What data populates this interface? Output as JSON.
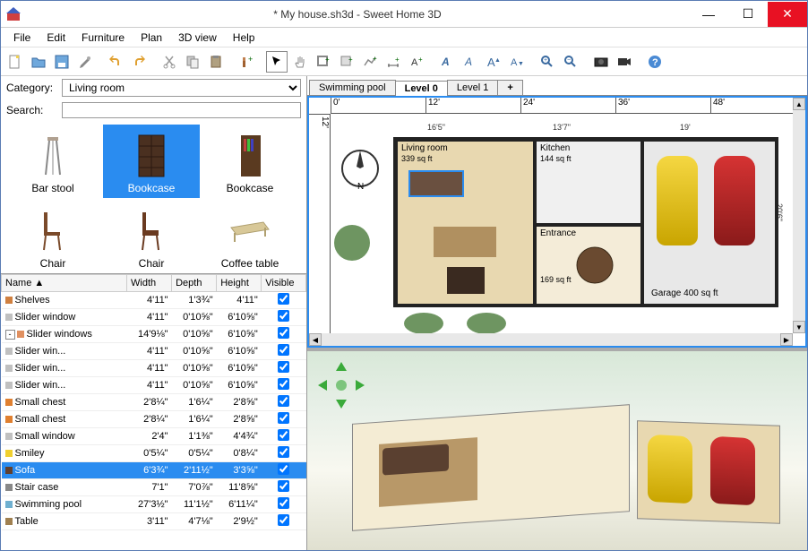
{
  "window": {
    "title": "* My house.sh3d - Sweet Home 3D"
  },
  "menu": {
    "file": "File",
    "edit": "Edit",
    "furniture": "Furniture",
    "plan": "Plan",
    "view3d": "3D view",
    "help": "Help"
  },
  "catalog": {
    "category_label": "Category:",
    "category_value": "Living room",
    "search_label": "Search:",
    "search_value": "",
    "items": [
      {
        "label": "Bar stool",
        "selected": false
      },
      {
        "label": "Bookcase",
        "selected": true
      },
      {
        "label": "Bookcase",
        "selected": false
      },
      {
        "label": "Chair",
        "selected": false
      },
      {
        "label": "Chair",
        "selected": false
      },
      {
        "label": "Coffee table",
        "selected": false
      }
    ]
  },
  "furniture_table": {
    "headers": {
      "name": "Name ▲",
      "width": "Width",
      "depth": "Depth",
      "height": "Height",
      "visible": "Visible"
    },
    "rows": [
      {
        "indent": 1,
        "icon": "#d08040",
        "name": "Shelves",
        "width": "4'11\"",
        "depth": "1'3¾\"",
        "height": "4'11\"",
        "visible": true
      },
      {
        "indent": 1,
        "icon": "#c0c0c0",
        "name": "Slider window",
        "width": "4'11\"",
        "depth": "0'10⅝\"",
        "height": "6'10⅝\"",
        "visible": true
      },
      {
        "indent": 0,
        "expand": "-",
        "icon": "#e09060",
        "name": "Slider windows",
        "width": "14'9⅛\"",
        "depth": "0'10⅝\"",
        "height": "6'10⅝\"",
        "visible": true
      },
      {
        "indent": 2,
        "icon": "#c0c0c0",
        "name": "Slider win...",
        "width": "4'11\"",
        "depth": "0'10⅝\"",
        "height": "6'10⅝\"",
        "visible": true
      },
      {
        "indent": 2,
        "icon": "#c0c0c0",
        "name": "Slider win...",
        "width": "4'11\"",
        "depth": "0'10⅝\"",
        "height": "6'10⅝\"",
        "visible": true
      },
      {
        "indent": 2,
        "icon": "#c0c0c0",
        "name": "Slider win...",
        "width": "4'11\"",
        "depth": "0'10⅝\"",
        "height": "6'10⅝\"",
        "visible": true
      },
      {
        "indent": 1,
        "icon": "#e08030",
        "name": "Small chest",
        "width": "2'8¼\"",
        "depth": "1'6¼\"",
        "height": "2'8⅝\"",
        "visible": true
      },
      {
        "indent": 1,
        "icon": "#e08030",
        "name": "Small chest",
        "width": "2'8¼\"",
        "depth": "1'6¼\"",
        "height": "2'8⅝\"",
        "visible": true
      },
      {
        "indent": 1,
        "icon": "#c0c0c0",
        "name": "Small window",
        "width": "2'4\"",
        "depth": "1'1⅜\"",
        "height": "4'4¾\"",
        "visible": true
      },
      {
        "indent": 1,
        "icon": "#f0d030",
        "name": "Smiley",
        "width": "0'5¼\"",
        "depth": "0'5¼\"",
        "height": "0'8¼\"",
        "visible": true
      },
      {
        "indent": 1,
        "icon": "#604030",
        "name": "Sofa",
        "width": "6'3¾\"",
        "depth": "2'11½\"",
        "height": "3'3⅝\"",
        "visible": true,
        "selected": true
      },
      {
        "indent": 1,
        "icon": "#888888",
        "name": "Stair case",
        "width": "7'1\"",
        "depth": "7'0⅞\"",
        "height": "11'8⅝\"",
        "visible": true
      },
      {
        "indent": 1,
        "icon": "#70b0d0",
        "name": "Swimming pool",
        "width": "27'3½\"",
        "depth": "11'1½\"",
        "height": "6'11¼\"",
        "visible": true
      },
      {
        "indent": 1,
        "icon": "#a08050",
        "name": "Table",
        "width": "3'11\"",
        "depth": "4'7⅛\"",
        "height": "2'9½\"",
        "visible": true
      }
    ]
  },
  "tabs": {
    "items": [
      "Swimming pool",
      "Level 0",
      "Level 1"
    ],
    "active": "Level 0",
    "add": "+"
  },
  "plan": {
    "ruler_h": [
      "0'",
      "12'",
      "24'",
      "36'",
      "48'"
    ],
    "ruler_v": [
      "12'"
    ],
    "compass": "N",
    "dimensions": {
      "living_w": "16'5\"",
      "kitchen_w": "13'7\"",
      "garage_w": "19'",
      "garage_h": "20'6\""
    },
    "rooms": {
      "living": {
        "name": "Living room",
        "area": "339 sq ft"
      },
      "kitchen": {
        "name": "Kitchen",
        "area": "144 sq ft"
      },
      "entrance": {
        "name": "Entrance",
        "area": "169 sq ft"
      },
      "garage": {
        "name": "Garage",
        "area": "400 sq ft"
      }
    }
  }
}
